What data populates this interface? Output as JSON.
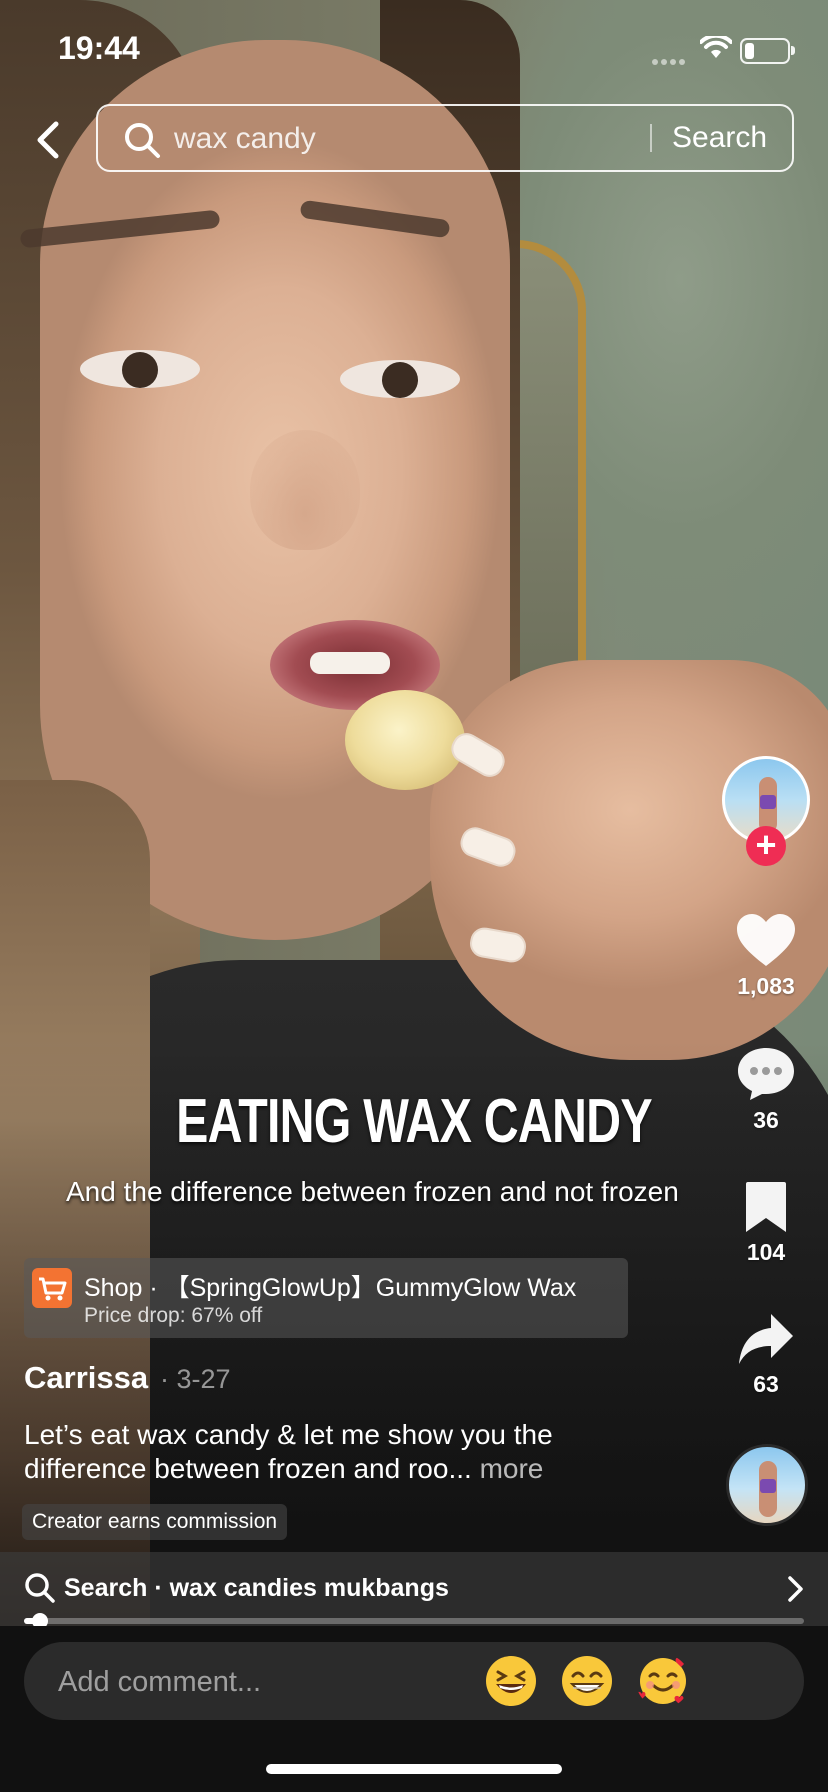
{
  "status_bar": {
    "time": "19:44"
  },
  "search": {
    "query": "wax candy",
    "button_label": "Search"
  },
  "video": {
    "headline": "EATING WAX CANDY",
    "subheadline": "And the difference between frozen and not frozen"
  },
  "rail": {
    "likes": "1,083",
    "comments": "36",
    "saves": "104",
    "shares": "63",
    "follow_symbol": "+"
  },
  "shop": {
    "title": "Shop · 【SpringGlowUp】GummyGlow Wax",
    "subtitle": "Price drop: 67% off"
  },
  "post": {
    "author": "Carrissa",
    "date": "· 3-27",
    "caption": "Let’s eat wax candy & let me show you the difference between frozen and roo...",
    "more_label": "more",
    "commission_label": "Creator earns commission"
  },
  "related_search": {
    "label": "Search · wax candies mukbangs"
  },
  "playback": {
    "progress": 0.02
  },
  "comment_bar": {
    "placeholder": "Add comment...",
    "emojis": [
      "grinning-squinting-face",
      "beaming-face",
      "smiling-face-with-hearts"
    ]
  },
  "colors": {
    "follow_red": "#ef2d54",
    "shop_orange": "#f37332"
  }
}
